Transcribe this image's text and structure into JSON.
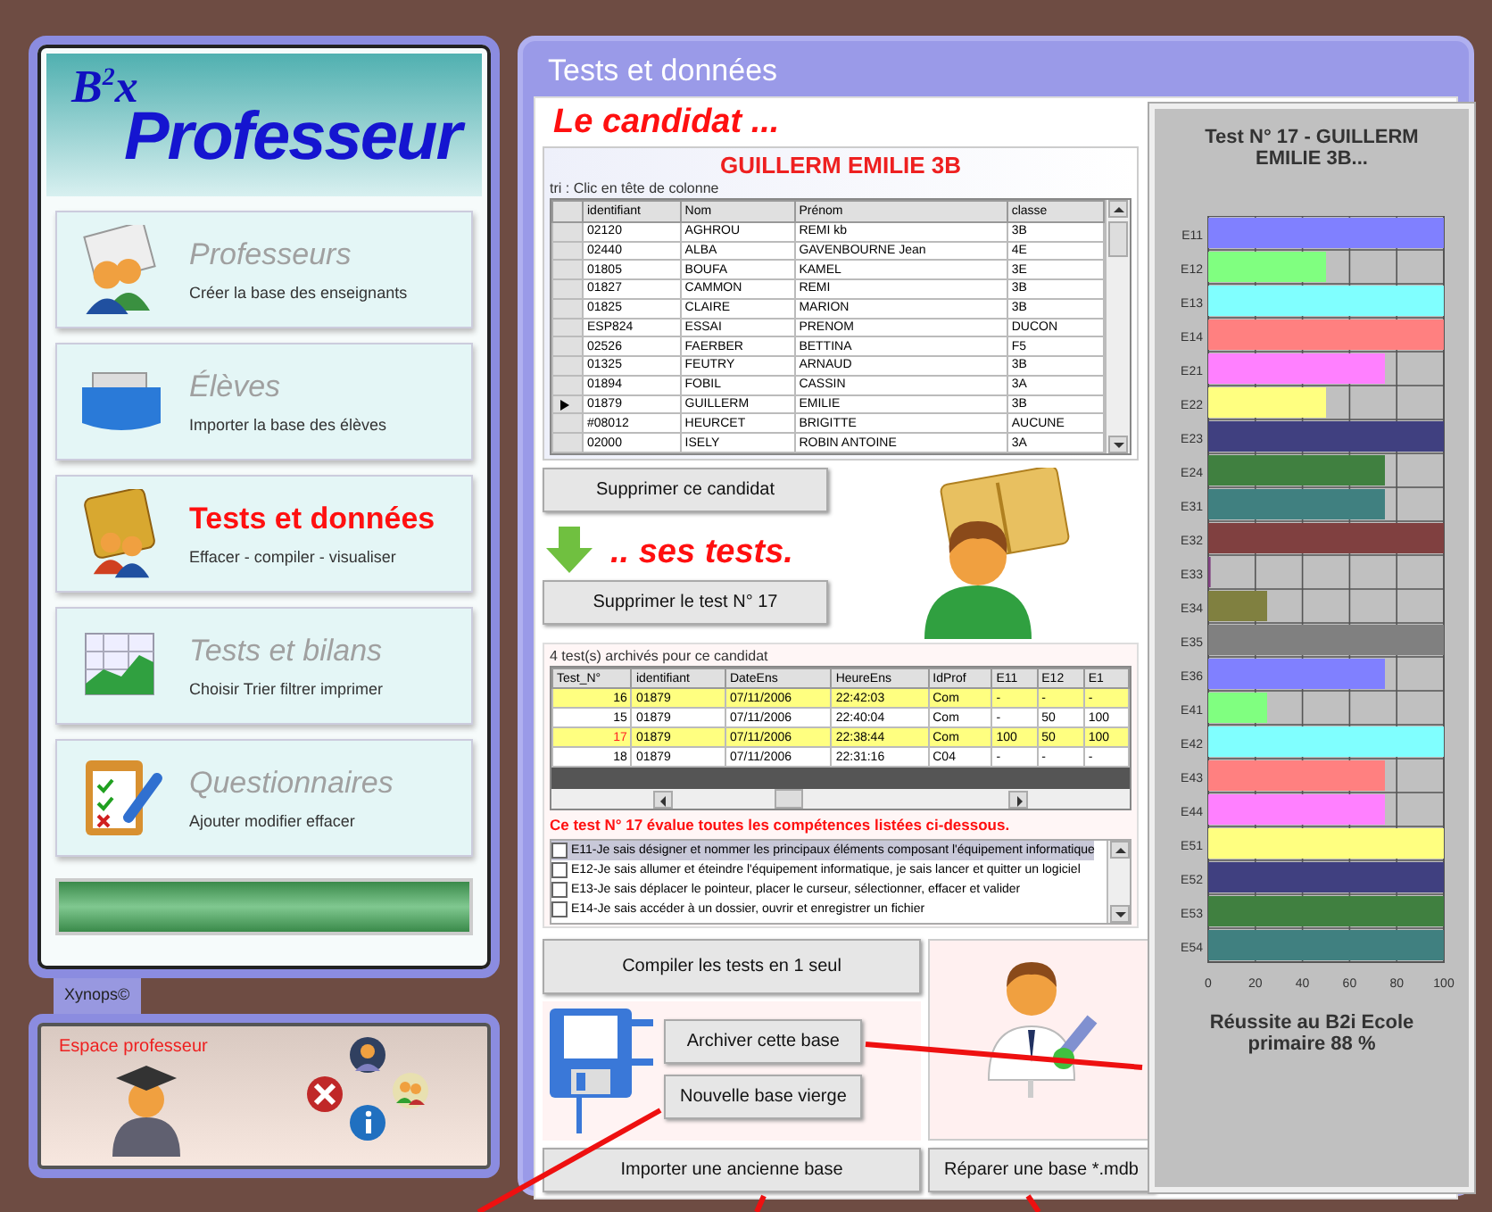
{
  "sidebar": {
    "logo": "B$^{2}$x",
    "title": "Professeur",
    "items": [
      {
        "kind": "teachers",
        "label": "Professeurs",
        "description": "Créer la base des enseignants",
        "selected": false
      },
      {
        "kind": "students",
        "label": "Élèves",
        "description": "Importer la base des élèves",
        "selected": false
      },
      {
        "kind": "tests",
        "label": "Tests et données",
        "description": "Effacer - compiler - visualiser",
        "selected": true
      },
      {
        "kind": "reports",
        "label": "Tests et bilans",
        "description": "Choisir Trier filtrer imprimer",
        "selected": false
      },
      {
        "kind": "questionnaires",
        "label": "Questionnaires",
        "description": "Ajouter modifier effacer",
        "selected": false
      }
    ],
    "footer_tab": "Xynops©"
  },
  "user_panel": {
    "label": "Espace professeur"
  },
  "window": {
    "title": "Tests et données"
  },
  "candidate": {
    "heading": "Le candidat ...",
    "name": "GUILLERM EMILIE 3B",
    "sort_hint": "tri : Clic en tête de colonne",
    "table": {
      "columns": [
        "identifiant",
        "Nom",
        "Prénom",
        "classe"
      ],
      "rows": [
        {
          "cells": [
            "02120",
            "AGHROU",
            "REMI kb",
            "3B"
          ],
          "selected": false
        },
        {
          "cells": [
            "02440",
            "ALBA",
            "GAVENBOURNE Jean",
            "4E"
          ],
          "selected": false
        },
        {
          "cells": [
            "01805",
            "BOUFA",
            "KAMEL",
            "3E"
          ],
          "selected": false
        },
        {
          "cells": [
            "01827",
            "CAMMON",
            "REMI",
            "3B"
          ],
          "selected": false
        },
        {
          "cells": [
            "01825",
            "CLAIRE",
            "MARION",
            "3B"
          ],
          "selected": false
        },
        {
          "cells": [
            "ESP824",
            "ESSAI",
            "PRENOM",
            "DUCON"
          ],
          "selected": false
        },
        {
          "cells": [
            "02526",
            "FAERBER",
            "BETTINA",
            "F5"
          ],
          "selected": false
        },
        {
          "cells": [
            "01325",
            "FEUTRY",
            "ARNAUD",
            "3B"
          ],
          "selected": false
        },
        {
          "cells": [
            "01894",
            "FOBIL",
            "CASSIN",
            "3A"
          ],
          "selected": false
        },
        {
          "cells": [
            "01879",
            "GUILLERM",
            "EMILIE",
            "3B"
          ],
          "selected": true
        },
        {
          "cells": [
            "#08012",
            "HEURCET",
            "BRIGITTE",
            "AUCUNE"
          ],
          "selected": false
        },
        {
          "cells": [
            "02000",
            "ISELY",
            "ROBIN ANTOINE",
            "3A"
          ],
          "selected": false
        }
      ]
    },
    "delete_button": "Supprimer ce candidat"
  },
  "tests": {
    "heading": ".. ses tests.",
    "delete_button": "Supprimer le test N° 17",
    "caption": "4 test(s) archivés pour ce candidat",
    "table": {
      "columns": [
        "Test_N°",
        "identifiant",
        "DateEns",
        "HeureEns",
        "IdProf",
        "E11",
        "E12",
        "E1"
      ],
      "rows": [
        {
          "cells": [
            "16",
            "01879",
            "07/11/2006",
            "22:42:03",
            "Com",
            "-",
            "-",
            "-"
          ],
          "highlighted": true,
          "selected": false
        },
        {
          "cells": [
            "15",
            "01879",
            "07/11/2006",
            "22:40:04",
            "Com",
            "-",
            "50",
            "100"
          ],
          "highlighted": false,
          "selected": false
        },
        {
          "cells": [
            "17",
            "01879",
            "07/11/2006",
            "22:38:44",
            "Com",
            "100",
            "50",
            "100"
          ],
          "highlighted": true,
          "selected": true
        },
        {
          "cells": [
            "18",
            "01879",
            "07/11/2006",
            "22:31:16",
            "C04",
            "-",
            "-",
            "-"
          ],
          "highlighted": false,
          "selected": false
        }
      ]
    },
    "statement": "Ce test N° 17 évalue toutes les compétences listées ci-dessous.",
    "competences": [
      {
        "label": "E11-Je sais désigner et nommer les principaux éléments composant l'équipement informatique",
        "checked": false,
        "selected": true
      },
      {
        "label": "E12-Je sais allumer et éteindre l'équipement informatique, je sais lancer et quitter un logiciel",
        "checked": false,
        "selected": false
      },
      {
        "label": "E13-Je sais déplacer le pointeur, placer le curseur, sélectionner, effacer et valider",
        "checked": false,
        "selected": false
      },
      {
        "label": "E14-Je sais accéder à un dossier, ouvrir et enregistrer un fichier",
        "checked": false,
        "selected": false
      }
    ],
    "compile_button": "Compiler les tests en 1 seul"
  },
  "database": {
    "archive_button": "Archiver cette base",
    "new_button": "Nouvelle base vierge",
    "import_button": "Importer une ancienne base",
    "repair_button": "Réparer une base *.mdb"
  },
  "chart_panel": {
    "chart_data": {
      "type": "bar",
      "orientation": "horizontal",
      "title": "Test N° 17 - GUILLERM EMILIE 3B...",
      "xlabel": "Réussite au B2i Ecole primaire 88 %",
      "categories": [
        "E11",
        "E12",
        "E13",
        "E14",
        "E21",
        "E22",
        "E23",
        "E24",
        "E31",
        "E32",
        "E33",
        "E34",
        "E35",
        "E36",
        "E41",
        "E42",
        "E43",
        "E44",
        "E51",
        "E52",
        "E53",
        "E54"
      ],
      "series": [
        {
          "color": "#8080ff",
          "values": [
            100,
            null,
            null,
            null,
            null,
            null,
            null,
            null,
            null,
            null,
            null,
            null,
            null,
            75,
            null,
            null,
            null,
            null,
            null,
            null,
            null,
            null
          ]
        },
        {
          "color": "#80ff80",
          "values": [
            null,
            50,
            null,
            null,
            null,
            null,
            null,
            null,
            null,
            null,
            null,
            null,
            null,
            null,
            25,
            null,
            null,
            null,
            null,
            null,
            null,
            null
          ]
        },
        {
          "color": "#80ffff",
          "values": [
            null,
            null,
            100,
            null,
            null,
            null,
            null,
            null,
            null,
            null,
            null,
            null,
            null,
            null,
            null,
            100,
            null,
            null,
            null,
            null,
            null,
            null
          ]
        },
        {
          "color": "#ff8080",
          "values": [
            null,
            null,
            null,
            100,
            null,
            null,
            null,
            null,
            null,
            null,
            null,
            null,
            null,
            null,
            null,
            null,
            75,
            null,
            null,
            null,
            null,
            null
          ]
        },
        {
          "color": "#ff80ff",
          "values": [
            null,
            null,
            null,
            null,
            75,
            null,
            null,
            null,
            null,
            null,
            null,
            null,
            null,
            null,
            null,
            null,
            null,
            75,
            null,
            null,
            null,
            null
          ]
        },
        {
          "color": "#ffff80",
          "values": [
            null,
            null,
            null,
            null,
            null,
            50,
            null,
            null,
            null,
            null,
            null,
            null,
            null,
            null,
            null,
            null,
            null,
            null,
            100,
            null,
            null,
            null
          ]
        },
        {
          "color": "#404080",
          "values": [
            null,
            null,
            null,
            null,
            null,
            null,
            100,
            null,
            null,
            null,
            null,
            null,
            null,
            null,
            null,
            null,
            null,
            null,
            null,
            100,
            null,
            null
          ]
        },
        {
          "color": "#408040",
          "values": [
            null,
            null,
            null,
            null,
            null,
            null,
            null,
            75,
            null,
            null,
            null,
            null,
            null,
            null,
            null,
            null,
            null,
            null,
            null,
            null,
            100,
            null
          ]
        },
        {
          "color": "#408080",
          "values": [
            null,
            null,
            null,
            null,
            null,
            null,
            null,
            null,
            75,
            null,
            null,
            null,
            null,
            null,
            null,
            null,
            null,
            null,
            null,
            null,
            null,
            100
          ]
        },
        {
          "color": "#804040",
          "values": [
            null,
            null,
            null,
            null,
            null,
            null,
            null,
            null,
            null,
            100,
            null,
            null,
            null,
            null,
            null,
            null,
            null,
            null,
            null,
            null,
            null,
            null
          ]
        },
        {
          "color": "#804080",
          "values": [
            null,
            null,
            null,
            null,
            null,
            null,
            null,
            null,
            null,
            null,
            1,
            null,
            null,
            null,
            null,
            null,
            null,
            null,
            null,
            null,
            null,
            null
          ]
        },
        {
          "color": "#808040",
          "values": [
            null,
            null,
            null,
            null,
            null,
            null,
            null,
            null,
            null,
            null,
            null,
            25,
            null,
            null,
            null,
            null,
            null,
            null,
            null,
            null,
            null,
            null
          ]
        },
        {
          "color": "#808080",
          "values": [
            null,
            null,
            null,
            null,
            null,
            null,
            null,
            null,
            null,
            null,
            null,
            null,
            100,
            null,
            null,
            null,
            null,
            null,
            null,
            null,
            null,
            null
          ]
        }
      ],
      "grid": true,
      "xlim": [
        0,
        100
      ],
      "xticks": [
        0,
        20,
        40,
        60,
        80,
        100
      ]
    }
  }
}
